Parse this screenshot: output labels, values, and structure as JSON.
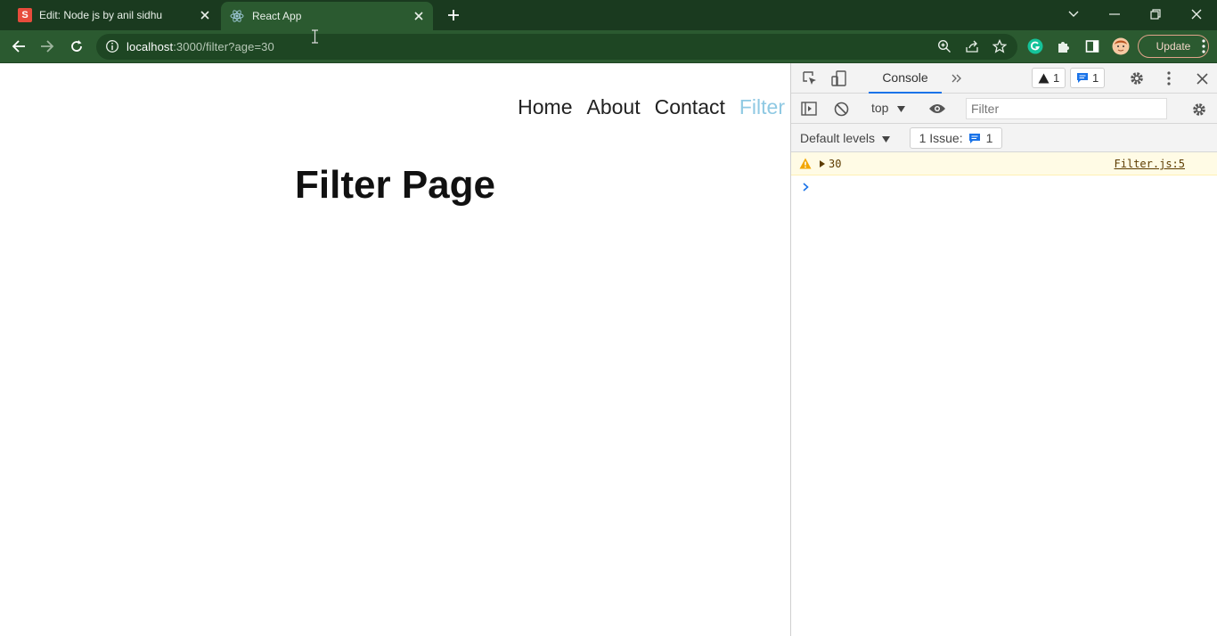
{
  "browser": {
    "tabs": [
      {
        "title": "Edit: Node js by anil sidhu",
        "favicon": "S"
      },
      {
        "title": "React App"
      }
    ],
    "url_host": "localhost",
    "url_rest": ":3000/filter?age=30",
    "update_label": "Update",
    "accent_colors": {
      "frame": "#1a3a1f",
      "toolbar": "#2b5a30"
    }
  },
  "page": {
    "nav": [
      "Home",
      "About",
      "Contact",
      "Filter"
    ],
    "active_nav": "Filter",
    "title": "Filter Page"
  },
  "devtools": {
    "console_tab": "Console",
    "warnings_count": "1",
    "messages_count": "1",
    "context": "top",
    "filter_placeholder": "Filter",
    "levels_label": "Default levels",
    "issues_label": "1 Issue:",
    "issues_count": "1",
    "log": {
      "value": "30",
      "source": "Filter.js:5"
    }
  }
}
